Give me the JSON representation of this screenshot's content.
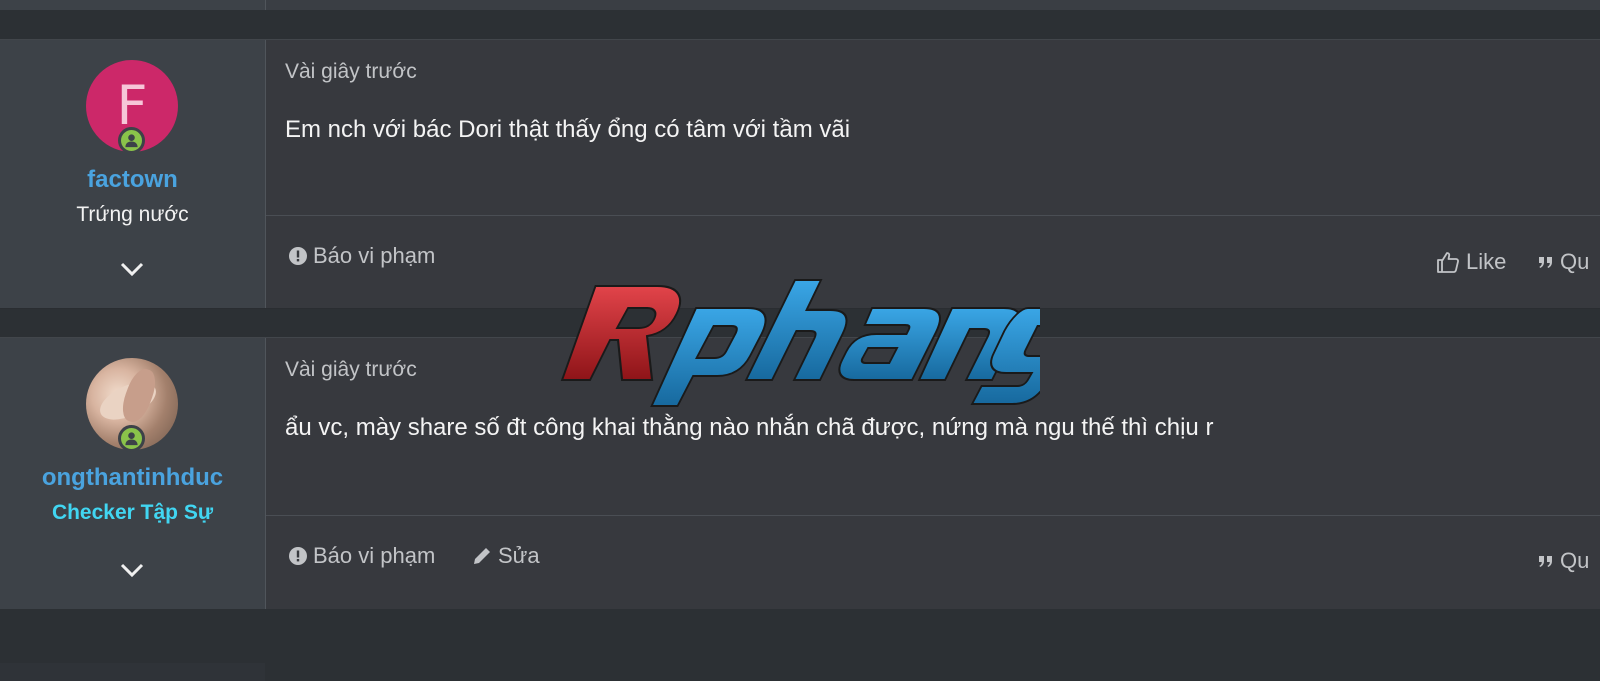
{
  "posts": [
    {
      "user": {
        "name": "factown",
        "title": "Trứng nước",
        "avatar_letter": "F",
        "avatar_color": "#cc2869",
        "online": true
      },
      "time": "Vài giây trước",
      "message": "Em nch với bác Dori thật thấy ổng có tâm với tầm vãi",
      "actions": {
        "report": "Báo vi phạm",
        "like": "Like",
        "quote": "Qu"
      }
    },
    {
      "user": {
        "name": "ongthantinhduc",
        "title": "Checker Tập Sự",
        "avatar_letter": "",
        "online": true
      },
      "time": "Vài giây trước",
      "message": "ẩu vc, mày share số đt công khai thằng nào nhắn chã được, nứng mà ngu thế thì chịu r",
      "actions": {
        "report": "Báo vi phạm",
        "edit": "Sửa",
        "quote": "Qu"
      }
    }
  ],
  "watermark": {
    "text": "Rphang",
    "color_r": "#c8252b",
    "color_rest": "#2a8fd0"
  },
  "colors": {
    "username": "#4aa3df",
    "checker_title": "#41d6f2",
    "online": "#8ac34a",
    "background": "#37393e",
    "sidebar": "#3d4248"
  },
  "icons": {
    "report": "exclamation-circle-icon",
    "edit": "pencil-icon",
    "like": "thumbs-up-icon",
    "quote": "quote-icon",
    "expand": "chevron-down-icon",
    "online": "user-online-icon"
  }
}
